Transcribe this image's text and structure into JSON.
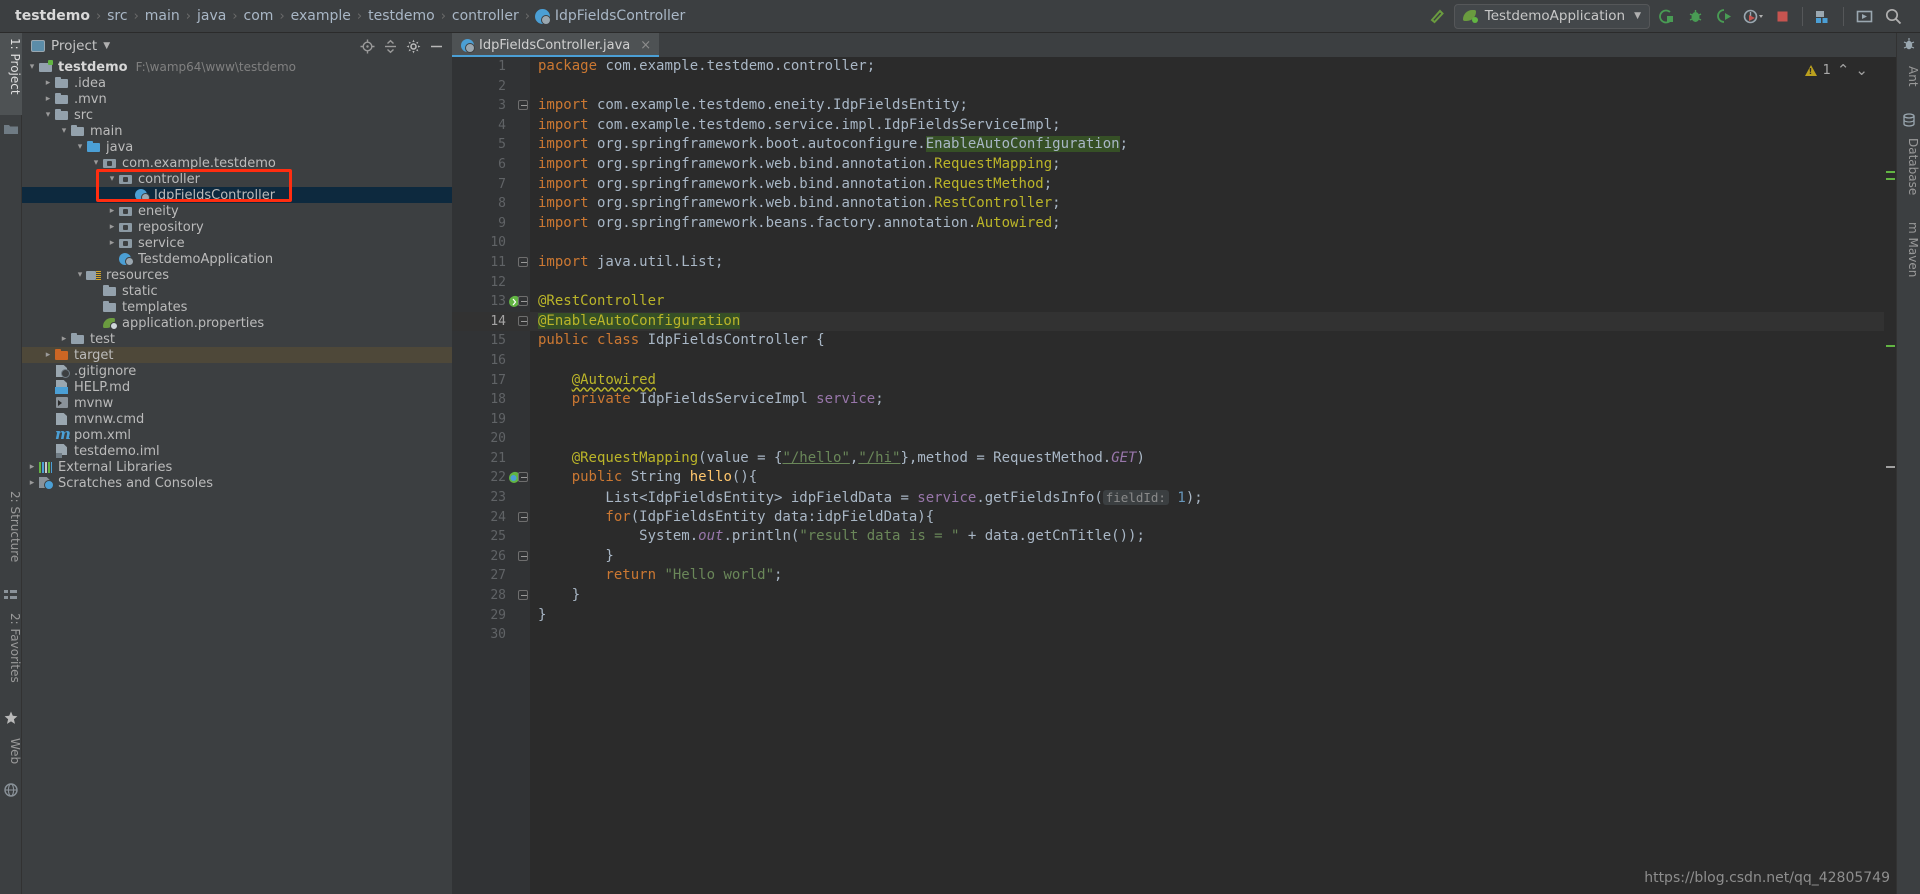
{
  "breadcrumb": {
    "items": [
      "testdemo",
      "src",
      "main",
      "java",
      "com",
      "example",
      "testdemo",
      "controller"
    ],
    "file": "IdpFieldsController",
    "separator": "›"
  },
  "toolbar": {
    "run_config": "TestdemoApplication",
    "chevron": "▼",
    "icons": [
      {
        "name": "build-icon"
      },
      {
        "name": "run-icon"
      },
      {
        "name": "debug-icon"
      },
      {
        "name": "run-with-coverage-icon"
      },
      {
        "name": "profile-icon"
      },
      {
        "name": "stop-icon"
      },
      {
        "name": "project-structure-icon"
      },
      {
        "name": "update-icon"
      },
      {
        "name": "search-everywhere-icon"
      }
    ]
  },
  "left_strip": {
    "tabs": [
      "1: Project",
      "2: Structure",
      "2: Favorites",
      "Web"
    ]
  },
  "right_strip": {
    "tabs": [
      "Ant",
      "Database",
      "m Maven"
    ]
  },
  "project_panel": {
    "title": "Project",
    "dropdown": "▼",
    "header_icons": [
      "locate-icon",
      "collapse-all-icon",
      "settings-gear-icon",
      "hide-icon"
    ],
    "tree": [
      {
        "depth": 0,
        "arrow": "down",
        "icon": "module-folder-icon",
        "label": "testdemo",
        "bold": true,
        "path": "F:\\wamp64\\www\\testdemo"
      },
      {
        "depth": 1,
        "arrow": "right",
        "icon": "folder-icon",
        "label": ".idea"
      },
      {
        "depth": 1,
        "arrow": "right",
        "icon": "folder-icon",
        "label": ".mvn"
      },
      {
        "depth": 1,
        "arrow": "down",
        "icon": "folder-icon",
        "label": "src"
      },
      {
        "depth": 2,
        "arrow": "down",
        "icon": "folder-icon",
        "label": "main"
      },
      {
        "depth": 3,
        "arrow": "down",
        "icon": "source-folder-icon",
        "label": "java"
      },
      {
        "depth": 4,
        "arrow": "down",
        "icon": "package-icon",
        "label": "com.example.testdemo"
      },
      {
        "depth": 5,
        "arrow": "down",
        "icon": "package-icon",
        "label": "controller"
      },
      {
        "depth": 6,
        "arrow": "none",
        "icon": "spring-class-icon",
        "label": "IdpFieldsController",
        "selected": true
      },
      {
        "depth": 5,
        "arrow": "right",
        "icon": "package-icon",
        "label": "eneity"
      },
      {
        "depth": 5,
        "arrow": "right",
        "icon": "package-icon",
        "label": "repository"
      },
      {
        "depth": 5,
        "arrow": "right",
        "icon": "package-icon",
        "label": "service"
      },
      {
        "depth": 5,
        "arrow": "none",
        "icon": "spring-class-icon",
        "label": "TestdemoApplication"
      },
      {
        "depth": 3,
        "arrow": "down",
        "icon": "resources-folder-icon",
        "label": "resources"
      },
      {
        "depth": 4,
        "arrow": "none",
        "icon": "folder-icon",
        "label": "static"
      },
      {
        "depth": 4,
        "arrow": "none",
        "icon": "folder-icon",
        "label": "templates"
      },
      {
        "depth": 4,
        "arrow": "none",
        "icon": "spring-config-icon",
        "label": "application.properties"
      },
      {
        "depth": 2,
        "arrow": "right",
        "icon": "folder-icon",
        "label": "test"
      },
      {
        "depth": 1,
        "arrow": "right",
        "icon": "excluded-folder-icon",
        "label": "target",
        "excluded": true
      },
      {
        "depth": 1,
        "arrow": "none",
        "icon": "gitignore-icon",
        "label": ".gitignore"
      },
      {
        "depth": 1,
        "arrow": "none",
        "icon": "markdown-icon",
        "label": "HELP.md"
      },
      {
        "depth": 1,
        "arrow": "none",
        "icon": "shell-script-icon",
        "label": "mvnw"
      },
      {
        "depth": 1,
        "arrow": "none",
        "icon": "file-icon",
        "label": "mvnw.cmd"
      },
      {
        "depth": 1,
        "arrow": "none",
        "icon": "maven-pom-icon",
        "label": "pom.xml"
      },
      {
        "depth": 1,
        "arrow": "none",
        "icon": "iml-module-icon",
        "label": "testdemo.iml"
      },
      {
        "depth": 0,
        "arrow": "right",
        "icon": "external-libraries-icon",
        "label": "External Libraries"
      },
      {
        "depth": 0,
        "arrow": "right",
        "icon": "scratches-icon",
        "label": "Scratches and Consoles"
      }
    ]
  },
  "editor": {
    "tab": {
      "label": "IdpFieldsController.java",
      "close": "×",
      "icon": "spring-class-icon"
    },
    "inspection": {
      "warning_count": "1",
      "up": "⌃",
      "down": "⌄"
    },
    "lines": [
      {
        "n": "1"
      },
      {
        "n": "2"
      },
      {
        "n": "3"
      },
      {
        "n": "4"
      },
      {
        "n": "5"
      },
      {
        "n": "6"
      },
      {
        "n": "7"
      },
      {
        "n": "8"
      },
      {
        "n": "9"
      },
      {
        "n": "10"
      },
      {
        "n": "11"
      },
      {
        "n": "12"
      },
      {
        "n": "13"
      },
      {
        "n": "14"
      },
      {
        "n": "15"
      },
      {
        "n": "16"
      },
      {
        "n": "17"
      },
      {
        "n": "18"
      },
      {
        "n": "19"
      },
      {
        "n": "20"
      },
      {
        "n": "21"
      },
      {
        "n": "22"
      },
      {
        "n": "23"
      },
      {
        "n": "24"
      },
      {
        "n": "25"
      },
      {
        "n": "26"
      },
      {
        "n": "27"
      },
      {
        "n": "28"
      },
      {
        "n": "29"
      },
      {
        "n": "30"
      }
    ],
    "code": {
      "l1_kw": "package",
      "l1_rest": " com.example.testdemo.controller;",
      "l3_kw": "import",
      "l3_rest": " com.example.testdemo.eneity.IdpFieldsEntity;",
      "l4_kw": "import",
      "l4_rest": " com.example.testdemo.service.impl.IdpFieldsServiceImpl;",
      "l5_kw": "import",
      "l5_pkg": " org.springframework.boot.autoconfigure.",
      "l5_cls": "EnableAutoConfiguration",
      "l5_end": ";",
      "l6_kw": "import",
      "l6_pkg": " org.springframework.web.bind.annotation.",
      "l6_cls": "RequestMapping",
      "l6_end": ";",
      "l7_kw": "import",
      "l7_pkg": " org.springframework.web.bind.annotation.",
      "l7_cls": "RequestMethod",
      "l7_end": ";",
      "l8_kw": "import",
      "l8_pkg": " org.springframework.web.bind.annotation.",
      "l8_cls": "RestController",
      "l8_end": ";",
      "l9_kw": "import",
      "l9_pkg": " org.springframework.beans.factory.annotation.",
      "l9_cls": "Autowired",
      "l9_end": ";",
      "l11_kw": "import",
      "l11_rest": " java.util.List;",
      "l13_anno": "@RestController",
      "l14_anno": "@EnableAutoConfiguration",
      "l15_kw1": "public",
      "l15_kw2": "class",
      "l15_name": "IdpFieldsController",
      "l15_brace": "{",
      "l17_anno": "@Autowired",
      "l18_kw": "private",
      "l18_type": "IdpFieldsServiceImpl",
      "l18_fld": "service",
      "l18_end": ";",
      "l21_anno": "@RequestMapping",
      "l21_p1": "(value = {",
      "l21_s1": "\"/hello\"",
      "l21_comma": ",",
      "l21_s2": "\"/hi\"",
      "l21_p2": "},method = RequestMethod.",
      "l21_get": "GET",
      "l21_p3": ")",
      "l22_kw": "public",
      "l22_type": "String",
      "l22_mth": "hello",
      "l22_end": "(){",
      "l23_type": "List<IdpFieldsEntity>",
      "l23_var": " idpFieldData = ",
      "l23_obj": "service",
      "l23_call": ".getFieldsInfo(",
      "l23_hint": "fieldId:",
      "l23_num": "1",
      "l23_end": ");",
      "l24_kw": "for",
      "l24_rest": "(IdpFieldsEntity data:idpFieldData){",
      "l25_sys": "System.",
      "l25_out": "out",
      "l25_p": ".println(",
      "l25_str": "\"result data is = \"",
      "l25_rest": " + data.getCnTitle());",
      "l26_brace": "}",
      "l27_kw": "return",
      "l27_str": "\"Hello world\"",
      "l27_end": ";",
      "l28_brace": "}",
      "l29_brace": "}"
    }
  },
  "watermark": "https://blog.csdn.net/qq_42805749",
  "colors": {
    "accent": "#4b9fd5",
    "selection": "#0d293e",
    "excluded": "#4e4839",
    "annotation_box": "#ff2d10",
    "keyword": "#cc7832",
    "string": "#6a8759",
    "annotation_text": "#bbb529",
    "field": "#9876aa",
    "method": "#ffc66d",
    "number": "#6897bb",
    "editor_bg": "#2b2b2b",
    "panel_bg": "#3c3f41"
  }
}
